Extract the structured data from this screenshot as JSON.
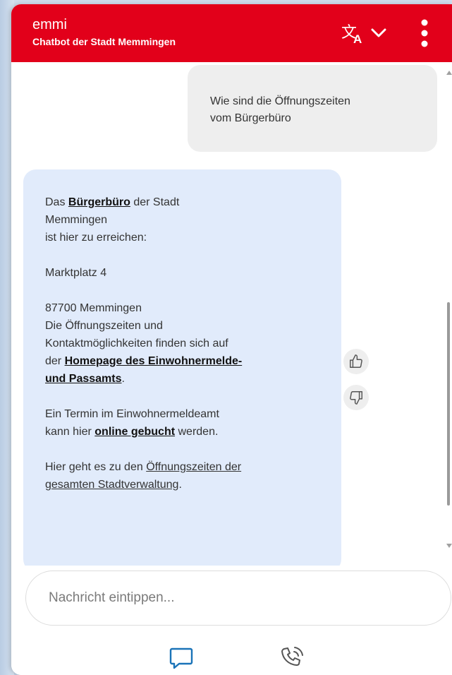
{
  "header": {
    "title": "emmi",
    "subtitle": "Chatbot der Stadt Memmingen",
    "translate_icon": "translate-icon",
    "menu_icon": "kebab-menu-icon",
    "color": "#e2001a"
  },
  "messages": {
    "user": {
      "line1": "Wie sind die Öffnungszeiten",
      "line2": "vom Bürgerbüro"
    },
    "bot": {
      "p1_pre": "Das ",
      "p1_link": "Bürgerbüro",
      "p1_post": " der Stadt",
      "p1_line2": "Memmingen",
      "p1_line3": "ist hier zu erreichen:",
      "address_street": "Marktplatz 4",
      "address_city": "87700 Memmingen",
      "p3_line1": "Die Öffnungszeiten und",
      "p3_line2": "Kontaktmöglichkeiten finden sich auf",
      "p3_pre": "der ",
      "p3_link_line1": "Homepage des Einwohnermelde-",
      "p3_link_line2": "und Passamts",
      "p3_post": ".",
      "p4_line1": "Ein Termin im Einwohnermeldeamt",
      "p4_pre": "kann hier ",
      "p4_link": "online gebucht",
      "p4_post": " werden.",
      "p5_pre": "Hier geht es zu den ",
      "p5_link_line1": "Öffnungszeiten der",
      "p5_link_line2": "gesamten Stadtverwaltung",
      "p5_post": "."
    }
  },
  "composer": {
    "placeholder": "Nachricht eintippen...",
    "chat_icon": "chat-bubble-icon",
    "phone_icon": "phone-call-icon"
  },
  "colors": {
    "user_bubble": "#eeeeee",
    "bot_bubble": "#e1ebfb",
    "icon_blue": "#1a73b8"
  }
}
